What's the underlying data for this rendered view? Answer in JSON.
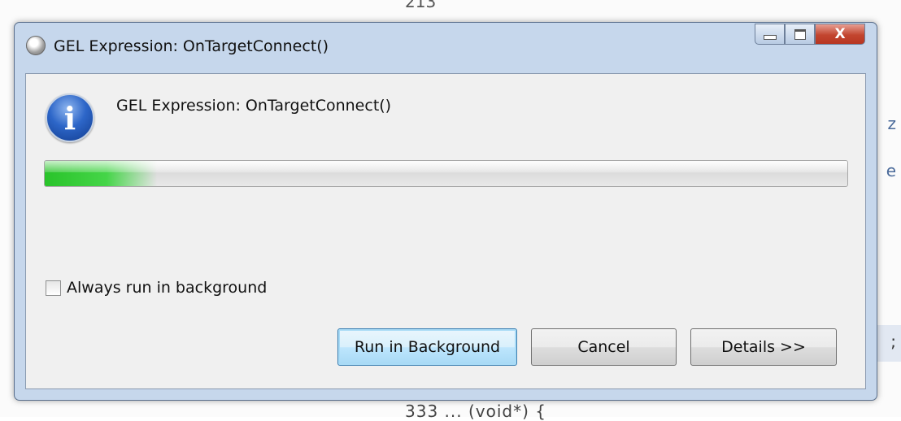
{
  "window": {
    "title": "GEL Expression: OnTargetConnect()",
    "title_icon": "application-gear-icon",
    "controls": {
      "minimize": "minimize",
      "maximize": "maximize",
      "close": "X"
    }
  },
  "dialog": {
    "icon": "information-icon",
    "message": "GEL Expression: OnTargetConnect()",
    "progress": 0.14,
    "checkbox": {
      "label": "Always run in background",
      "checked": false
    },
    "buttons": {
      "run_in_background": "Run in Background",
      "cancel": "Cancel",
      "details": "Details >>"
    }
  },
  "background": {
    "code_top": "213",
    "code_bottom": "333 ... (void*) {"
  },
  "colors": {
    "progress_green": "#2bc32b",
    "close_red": "#c2452f",
    "titlebar": "#c6d7ec"
  }
}
